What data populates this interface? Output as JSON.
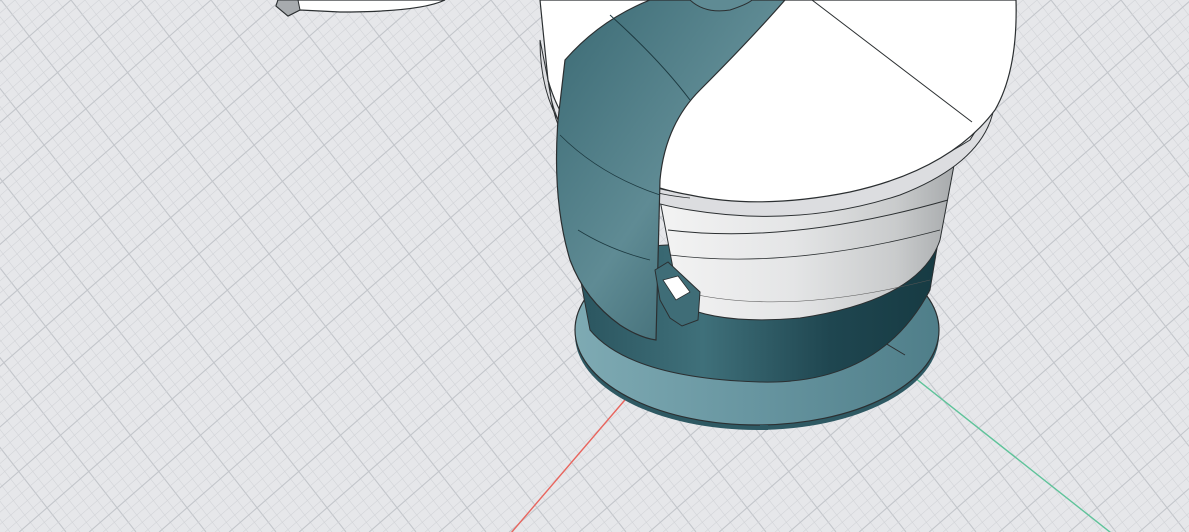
{
  "viewport": {
    "kind": "3d-modeling-viewport",
    "background_color": "#e6e7ea",
    "grid": {
      "visible": true,
      "minor_line_color": "#d2d4d8",
      "major_line_color": "#c3c6cb"
    },
    "axes": {
      "x_axis_color": "#e8655e",
      "z_axis_color": "#5fc39a"
    },
    "model": {
      "name": "cylindrical-device",
      "shell_color": "#e9eaea",
      "lid_color": "#ffffff",
      "accent_color": "#2d5c66",
      "base_color": "#6e9ba4",
      "edge_color": "#2b2f31"
    },
    "secondary_model": {
      "shell_color": "#ffffff",
      "accent_color": "#8a8d90"
    }
  }
}
